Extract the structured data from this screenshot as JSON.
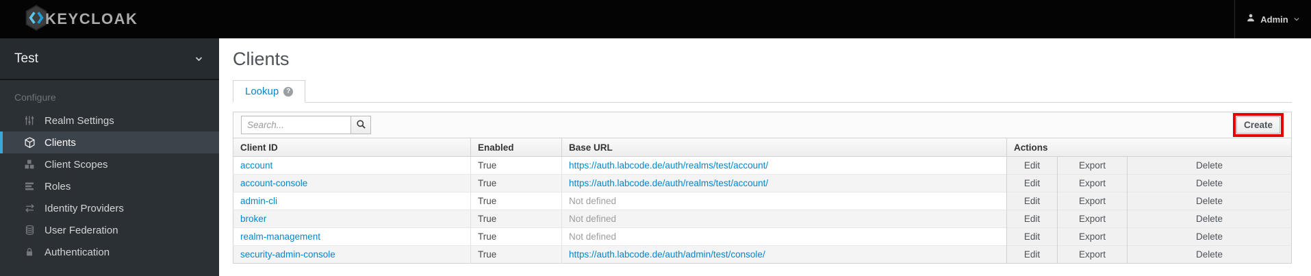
{
  "topbar": {
    "brand": "KEYCLOAK",
    "user": {
      "name": "Admin"
    }
  },
  "sidebar": {
    "realm": "Test",
    "section_label": "Configure",
    "items": [
      {
        "label": "Realm Settings",
        "icon": "sliders-icon",
        "active": false
      },
      {
        "label": "Clients",
        "icon": "cube-icon",
        "active": true
      },
      {
        "label": "Client Scopes",
        "icon": "cubes-icon",
        "active": false
      },
      {
        "label": "Roles",
        "icon": "list-icon",
        "active": false
      },
      {
        "label": "Identity Providers",
        "icon": "exchange-icon",
        "active": false
      },
      {
        "label": "User Federation",
        "icon": "database-icon",
        "active": false
      },
      {
        "label": "Authentication",
        "icon": "lock-icon",
        "active": false
      }
    ]
  },
  "main": {
    "title": "Clients",
    "tab": {
      "label": "Lookup",
      "help_icon": "question-circle-icon"
    },
    "toolbar": {
      "search_placeholder": "Search...",
      "search_icon": "magnifier-icon",
      "create_label": "Create"
    },
    "table": {
      "headers": [
        "Client ID",
        "Enabled",
        "Base URL",
        "Actions"
      ],
      "action_labels": [
        "Edit",
        "Export",
        "Delete"
      ],
      "rows": [
        {
          "client_id": "account",
          "enabled": "True",
          "base_url": "https://auth.labcode.de/auth/realms/test/account/",
          "url_defined": true
        },
        {
          "client_id": "account-console",
          "enabled": "True",
          "base_url": "https://auth.labcode.de/auth/realms/test/account/",
          "url_defined": true
        },
        {
          "client_id": "admin-cli",
          "enabled": "True",
          "base_url": "Not defined",
          "url_defined": false
        },
        {
          "client_id": "broker",
          "enabled": "True",
          "base_url": "Not defined",
          "url_defined": false
        },
        {
          "client_id": "realm-management",
          "enabled": "True",
          "base_url": "Not defined",
          "url_defined": false
        },
        {
          "client_id": "security-admin-console",
          "enabled": "True",
          "base_url": "https://auth.labcode.de/auth/admin/test/console/",
          "url_defined": true
        }
      ]
    }
  },
  "colors": {
    "link_accent": "#0088ce",
    "sidebar_active_indicator": "#39a9dc",
    "annotation_highlight": "#e60000",
    "topbar_bg": "#040404",
    "sidebar_bg": "#2b3035"
  }
}
